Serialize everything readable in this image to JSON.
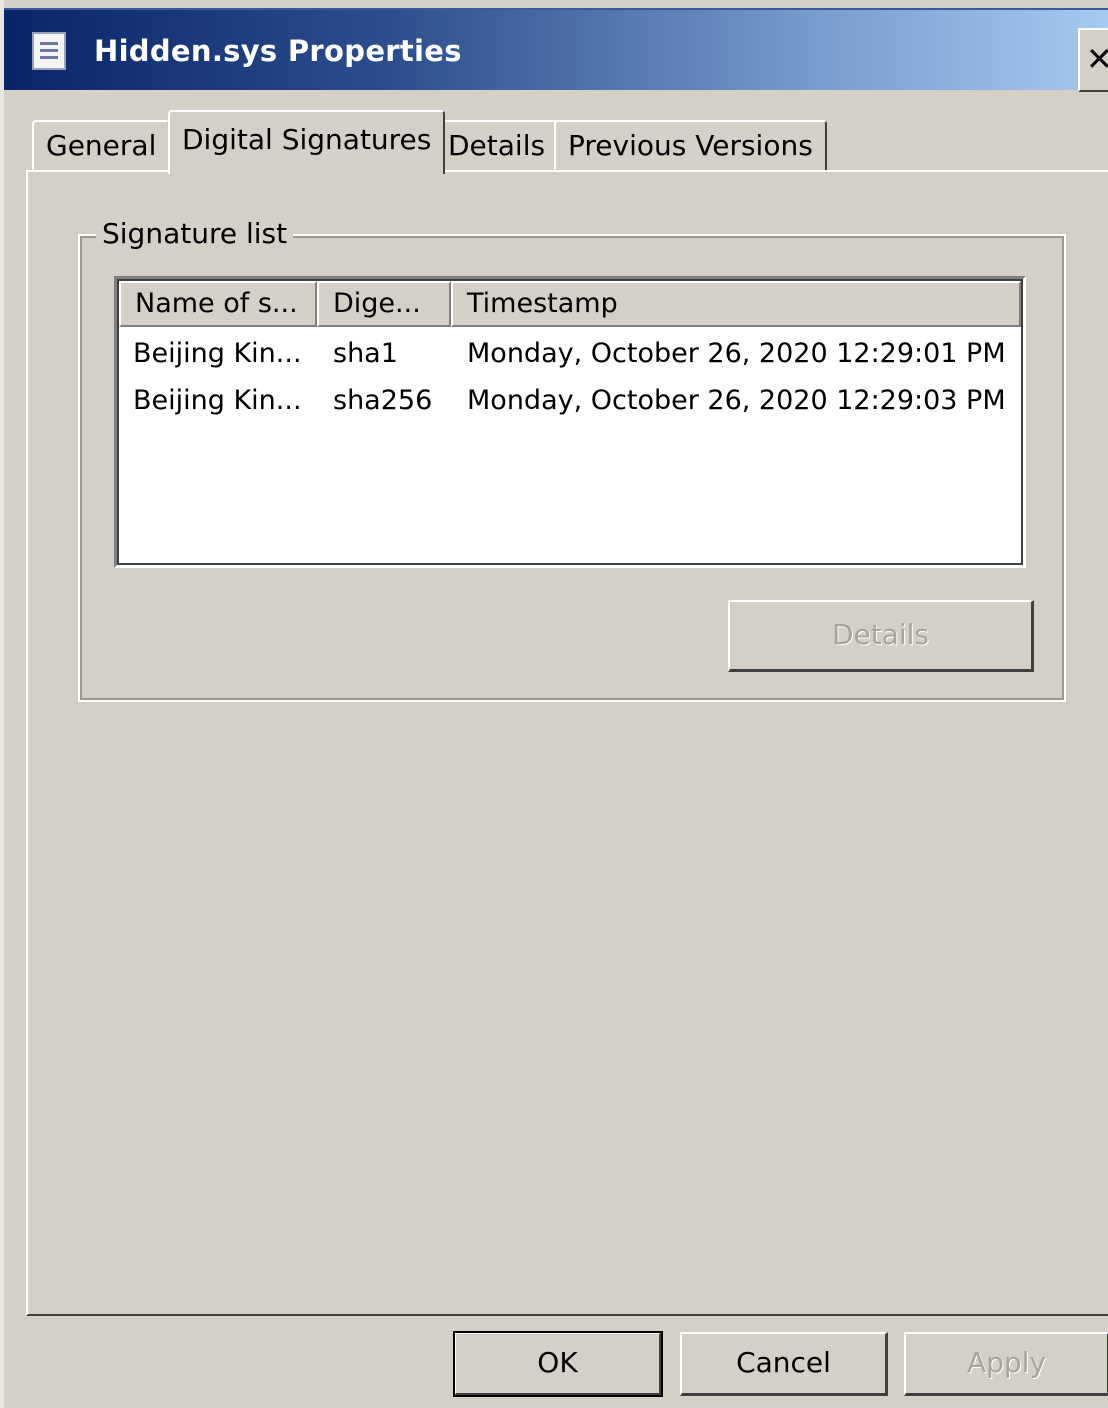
{
  "window": {
    "title": "Hidden.sys Properties",
    "close_symbol": "✕"
  },
  "tabs": [
    {
      "label": "General",
      "active": false
    },
    {
      "label": "Digital Signatures",
      "active": true
    },
    {
      "label": "Details",
      "active": false
    },
    {
      "label": "Previous Versions",
      "active": false
    }
  ],
  "signature_list": {
    "group_label": "Signature list",
    "columns": [
      "Name of s...",
      "Dige...",
      "Timestamp"
    ],
    "rows": [
      {
        "name": "Beijing Kin...",
        "digest": "sha1",
        "timestamp": "Monday, October 26, 2020 12:29:01 PM"
      },
      {
        "name": "Beijing Kin...",
        "digest": "sha256",
        "timestamp": "Monday, October 26, 2020 12:29:03 PM"
      }
    ],
    "details_label": "Details"
  },
  "footer": {
    "ok_label": "OK",
    "cancel_label": "Cancel",
    "apply_label": "Apply"
  },
  "colors": {
    "titlebar_start": "#0a246a",
    "titlebar_end": "#a6caf0",
    "face": "#d4d0c8"
  }
}
